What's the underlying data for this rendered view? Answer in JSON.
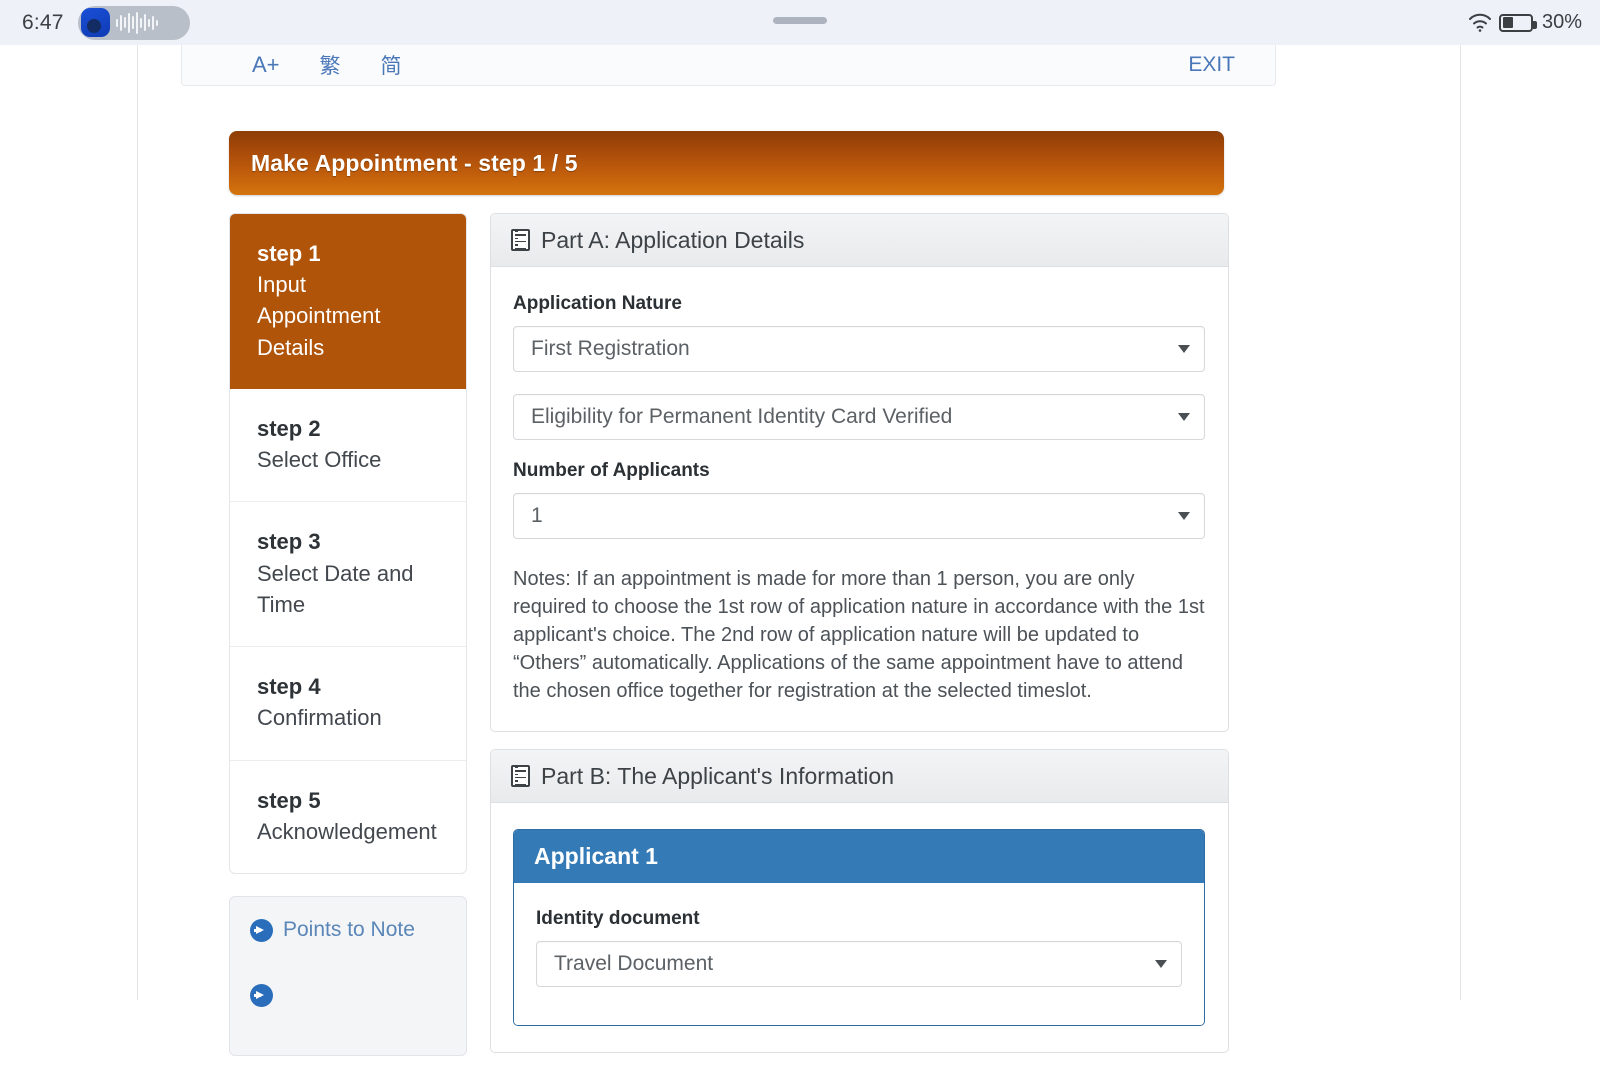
{
  "statusbar": {
    "clock": "6:47",
    "app_icon": "recording-app-icon",
    "waveform_icon": "audio-waveform-icon",
    "wifi_icon": "wifi-icon",
    "battery_icon": "battery-icon",
    "battery_percent": "30%"
  },
  "utilbar": {
    "font_size_label": "A+",
    "traditional_label": "繁",
    "simplified_label": "简",
    "exit_label": "EXIT"
  },
  "banner": {
    "title": "Make Appointment - step 1 / 5",
    "accent_color": "#b0540a"
  },
  "sidebar": {
    "steps": [
      {
        "no": "step 1",
        "label_line1": "Input",
        "label_line2": "Appointment",
        "label_line3": "Details",
        "active": true
      },
      {
        "no": "step 2",
        "label_line1": "Select Office",
        "active": false
      },
      {
        "no": "step 3",
        "label_line1": "Select Date and",
        "label_line2": "Time",
        "active": false
      },
      {
        "no": "step 4",
        "label_line1": "Confirmation",
        "active": false
      },
      {
        "no": "step 5",
        "label_line1": "Acknowledgement",
        "active": false
      }
    ],
    "note_panel": {
      "link_label": "Points to Note",
      "link_color": "#5a86b8"
    }
  },
  "part_a": {
    "heading": "Part A: Application Details",
    "application_nature_label": "Application Nature",
    "application_nature_value": "First Registration",
    "eligibility_value": "Eligibility for Permanent Identity Card Verified",
    "number_of_applicants_label": "Number of Applicants",
    "number_of_applicants_value": "1",
    "notes": "Notes: If an appointment is made for more than 1 person, you are only required to choose the 1st row of application nature in accordance with the 1st applicant's choice. The 2nd row of application nature will be updated to “Others” automatically. Applications of the same appointment have to attend the chosen office together for registration at the selected timeslot."
  },
  "part_b": {
    "heading": "Part B: The Applicant's Information",
    "applicant_title": "Applicant 1",
    "identity_document_label": "Identity document",
    "identity_document_value": "Travel Document",
    "header_color": "#337ab7"
  }
}
